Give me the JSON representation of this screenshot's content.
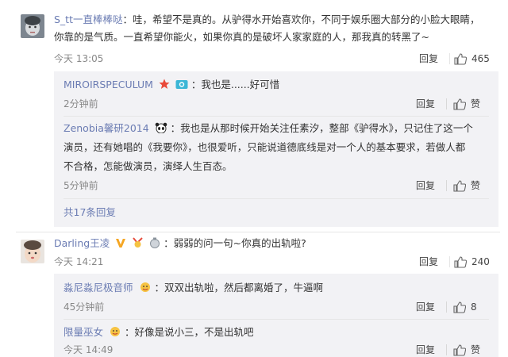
{
  "comments": [
    {
      "username": "S_tt一直棒棒哒",
      "text_line1": "：哇，希望不是真的。从驴得水开始喜欢你，不同于娱乐圈大部分的小脸大眼睛，",
      "text_line2": "你靠的是气质。一直希望你能火，如果你真的是破坏人家家庭的人，那我真的转黑了~",
      "time": "今天 13:05",
      "reply_label": "回复",
      "like_count": "465",
      "replies": [
        {
          "username": "MIROIRSPECULUM",
          "text": "：我也是......好可惜",
          "time": "2分钟前",
          "reply_label": "回复",
          "like_label": "赞"
        },
        {
          "username": "Zenobia馨研2014",
          "text_line1": "：我也是从那时候开始关注任素汐，整部《驴得水》，只记住了这一个",
          "text_line2": "演员，还有她唱的《我要你》，也很爱听，只能说道德底线是对一个人的基本要求，若做人都",
          "text_line3": "不合格，怎能做演员，演绎人生百态。",
          "time": "5分钟前",
          "reply_label": "回复",
          "like_label": "赞"
        }
      ],
      "more_replies": "共17条回复"
    },
    {
      "username": "Darling王凌",
      "text": "：弱弱的问一句~你真的出轨啦?",
      "time": "今天 14:21",
      "reply_label": "回复",
      "like_count": "240",
      "replies": [
        {
          "username": "淼尼淼尼极音师",
          "text": "：双双出轨啦，然后都离婚了，牛逼啊",
          "time": "45分钟前",
          "reply_label": "回复",
          "like_count": "8"
        },
        {
          "username": "限量巫女",
          "text": "：好像是说小三，不是出轨吧",
          "time": "今天 14:49",
          "reply_label": "回复",
          "like_label": "赞"
        }
      ]
    }
  ],
  "colors": {
    "name_link": "#6b7cb3",
    "reply_box_bg": "#f2f2f5",
    "time": "#888888"
  }
}
